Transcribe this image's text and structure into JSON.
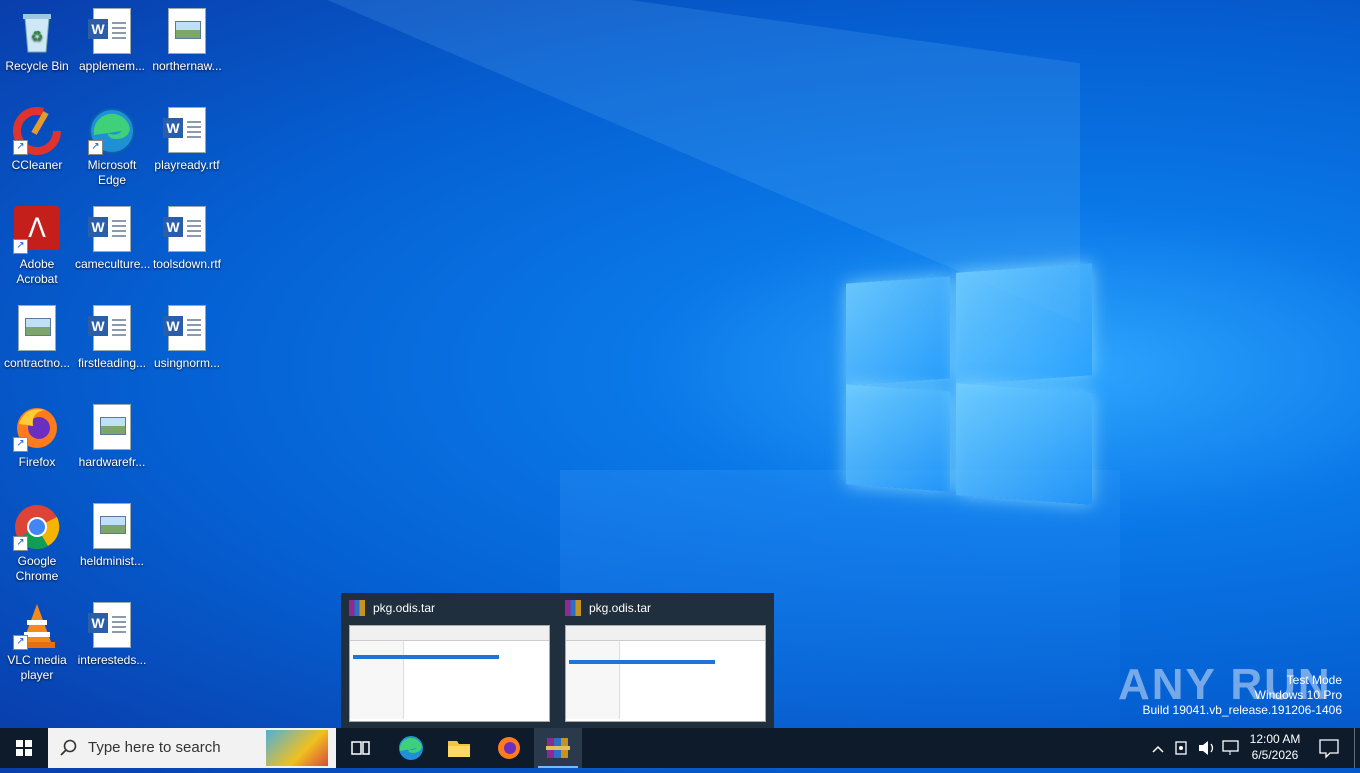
{
  "desktop": {
    "icons": [
      {
        "label": "Recycle Bin"
      },
      {
        "label": "applemem..."
      },
      {
        "label": "northernaw..."
      },
      {
        "label": "CCleaner"
      },
      {
        "label": "Microsoft Edge"
      },
      {
        "label": "playready.rtf"
      },
      {
        "label": "Adobe Acrobat"
      },
      {
        "label": "cameculture..."
      },
      {
        "label": "toolsdown.rtf"
      },
      {
        "label": "contractno..."
      },
      {
        "label": "firstleading..."
      },
      {
        "label": "usingnorm..."
      },
      {
        "label": "Firefox"
      },
      {
        "label": "hardwarefr..."
      },
      {
        "label": "Google Chrome"
      },
      {
        "label": "heldminist..."
      },
      {
        "label": "VLC media player"
      },
      {
        "label": "interesteds..."
      }
    ]
  },
  "thumbnails": [
    {
      "title": "pkg.odis.tar"
    },
    {
      "title": "pkg.odis.tar"
    }
  ],
  "taskbar": {
    "search_placeholder": "Type here to search",
    "clock_time": "12:00 AM",
    "clock_date": "6/5/2026"
  },
  "watermark": {
    "line1": "Test Mode",
    "line2": "Windows 10 Pro",
    "line3": "Build 19041.vb_release.191206-1406",
    "brand": "ANY RUN"
  },
  "colors": {
    "taskbar": "#0d1b2a",
    "accent": "#7ab8ff"
  }
}
